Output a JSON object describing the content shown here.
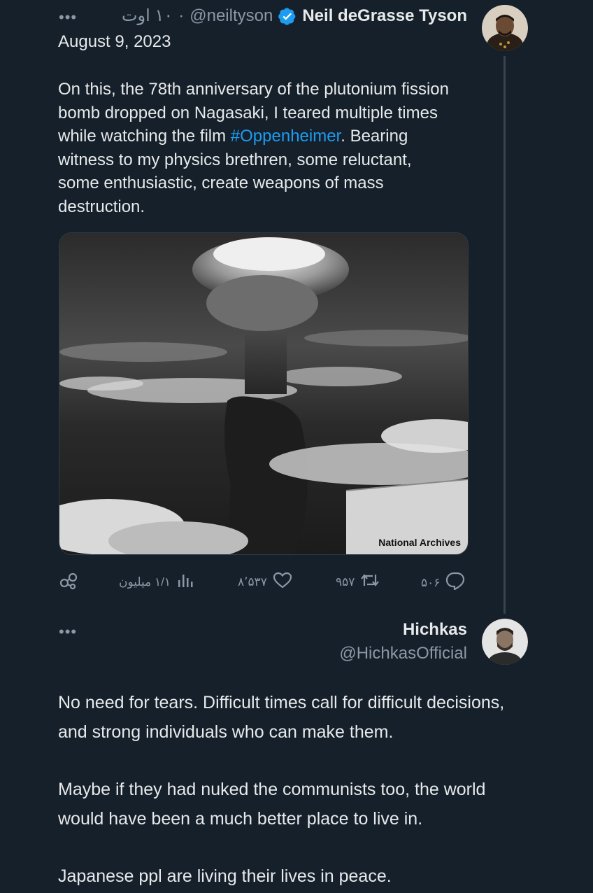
{
  "tweet": {
    "more_label": "•••",
    "time_label": "۱۰ اوت",
    "separator": "·",
    "handle": "@neiltyson",
    "name": "Neil deGrasse Tyson",
    "date": "August 9, 2023",
    "text_before": "On this, the 78th anniversary of the plutonium fission bomb dropped on Nagasaki, I teared multiple times while watching the film ",
    "hashtag": "#Oppenheimer",
    "text_after": ". Bearing witness to my physics brethren, some reluctant, some enthusiastic, create weapons of mass destruction.",
    "media_credit": "National Archives",
    "actions": {
      "views": "۱/۱ میلیون",
      "likes": "۸٬۵۳۷",
      "retweets": "۹۵۷",
      "replies": "۵۰۶"
    },
    "colors": {
      "verified": "#1d9bf0",
      "hashtag": "#1d9bf0"
    }
  },
  "reply": {
    "more_label": "•••",
    "name": "Hichkas",
    "handle": "@HichkasOfficial",
    "paragraphs": [
      "No need for tears. Difficult times call for difficult decisions, and strong individuals who can make them.",
      "Maybe if they had nuked the communists too, the world would have been a much better place to live in.",
      "Japanese ppl are living their lives in peace."
    ]
  },
  "icons": [
    "more-icon",
    "verified-badge-icon",
    "share-icon",
    "views-icon",
    "like-icon",
    "retweet-icon",
    "reply-icon"
  ]
}
